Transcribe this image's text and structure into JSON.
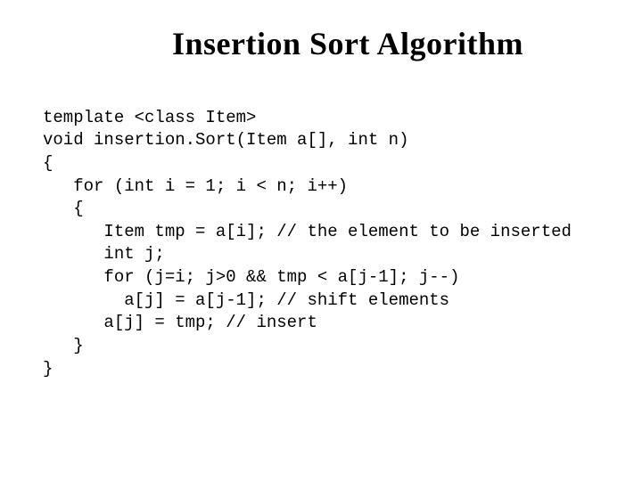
{
  "title": "Insertion Sort Algorithm",
  "code": {
    "l0": "template <class Item>",
    "l1": "void insertion.Sort(Item a[], int n)",
    "l2": "{",
    "l3": "   for (int i = 1; i < n; i++)",
    "l4": "   {",
    "l5": "      Item tmp = a[i]; // the element to be inserted",
    "l6": "      int j;",
    "l7": "      for (j=i; j>0 && tmp < a[j-1]; j--)",
    "l8": "        a[j] = a[j-1]; // shift elements",
    "l9": "      a[j] = tmp; // insert",
    "l10": "   }",
    "l11": "}"
  }
}
